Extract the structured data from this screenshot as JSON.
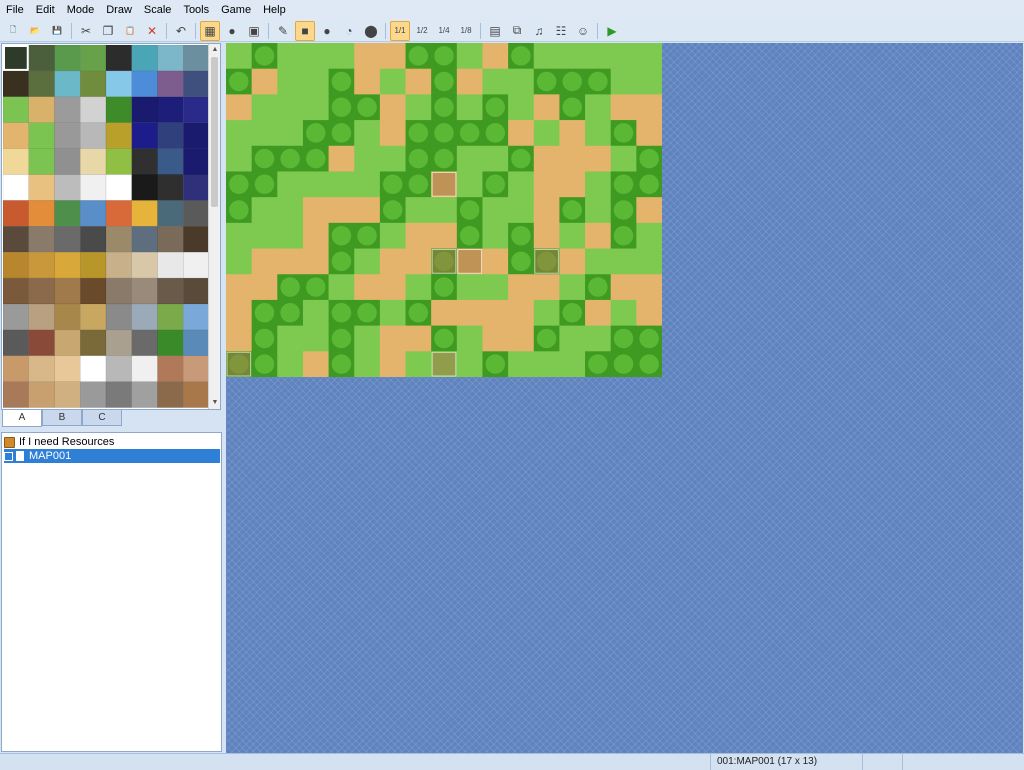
{
  "menu": [
    "File",
    "Edit",
    "Mode",
    "Draw",
    "Scale",
    "Tools",
    "Game",
    "Help"
  ],
  "toolbar": {
    "buttons": [
      {
        "name": "new-project-button",
        "icon": "new-file-icon",
        "glyph": "🗋"
      },
      {
        "name": "open-project-button",
        "icon": "open-folder-icon",
        "glyph": "📂"
      },
      {
        "name": "save-project-button",
        "icon": "save-icon",
        "glyph": "💾"
      },
      {
        "sep": true
      },
      {
        "name": "cut-button",
        "icon": "scissors-icon",
        "glyph": "✂"
      },
      {
        "name": "copy-button",
        "icon": "copy-icon",
        "glyph": "❐"
      },
      {
        "name": "paste-button",
        "icon": "paste-icon",
        "glyph": "📋"
      },
      {
        "name": "delete-button",
        "icon": "delete-x-icon",
        "glyph": "✕"
      },
      {
        "sep": true
      },
      {
        "name": "undo-button",
        "icon": "undo-icon",
        "glyph": "↶"
      },
      {
        "sep": true
      },
      {
        "name": "map-mode-button",
        "icon": "map-mode-icon",
        "glyph": "▦",
        "active": true
      },
      {
        "name": "event-mode-button",
        "icon": "event-mode-icon",
        "glyph": "●"
      },
      {
        "name": "region-mode-button",
        "icon": "region-mode-icon",
        "glyph": "▣"
      },
      {
        "sep": true
      },
      {
        "name": "pencil-button",
        "icon": "pencil-icon",
        "glyph": "✎"
      },
      {
        "name": "rectangle-button",
        "icon": "rectangle-icon",
        "glyph": "■",
        "active": true
      },
      {
        "name": "ellipse-button",
        "icon": "ellipse-icon",
        "glyph": "●"
      },
      {
        "name": "flood-fill-button",
        "icon": "flood-fill-icon",
        "glyph": "◔"
      },
      {
        "name": "shadow-pen-button",
        "icon": "shadow-pen-icon",
        "glyph": "⬤"
      },
      {
        "sep": true
      },
      {
        "name": "scale-1-1-button",
        "icon": "scale-1-1-icon",
        "glyph": "1/1",
        "active": true
      },
      {
        "name": "scale-1-2-button",
        "icon": "scale-1-2-icon",
        "glyph": "1/2"
      },
      {
        "name": "scale-1-4-button",
        "icon": "scale-1-4-icon",
        "glyph": "1/4"
      },
      {
        "name": "scale-1-8-button",
        "icon": "scale-1-8-icon",
        "glyph": "1/8"
      },
      {
        "sep": true
      },
      {
        "name": "database-button",
        "icon": "database-icon",
        "glyph": "▤"
      },
      {
        "name": "plugin-manager-button",
        "icon": "plugin-icon",
        "glyph": "⧉"
      },
      {
        "name": "sound-test-button",
        "icon": "sound-test-icon",
        "glyph": "♫"
      },
      {
        "name": "event-searcher-button",
        "icon": "event-search-icon",
        "glyph": "☷"
      },
      {
        "name": "character-generator-button",
        "icon": "character-icon",
        "glyph": "☺"
      },
      {
        "sep": true
      },
      {
        "name": "playtest-button",
        "icon": "play-icon",
        "glyph": "▶"
      }
    ]
  },
  "tileset_tabs": [
    "A",
    "B",
    "C"
  ],
  "map_tree": {
    "project": "If I need Resources",
    "maps": [
      "MAP001"
    ]
  },
  "status": {
    "map_info": "001:MAP001 (17 x 13)"
  },
  "map": {
    "grass_color": "#7ec950",
    "dirt_color": "#e4b46c",
    "bush_color": "#3f9a22",
    "water_color": "#5f83bf"
  }
}
